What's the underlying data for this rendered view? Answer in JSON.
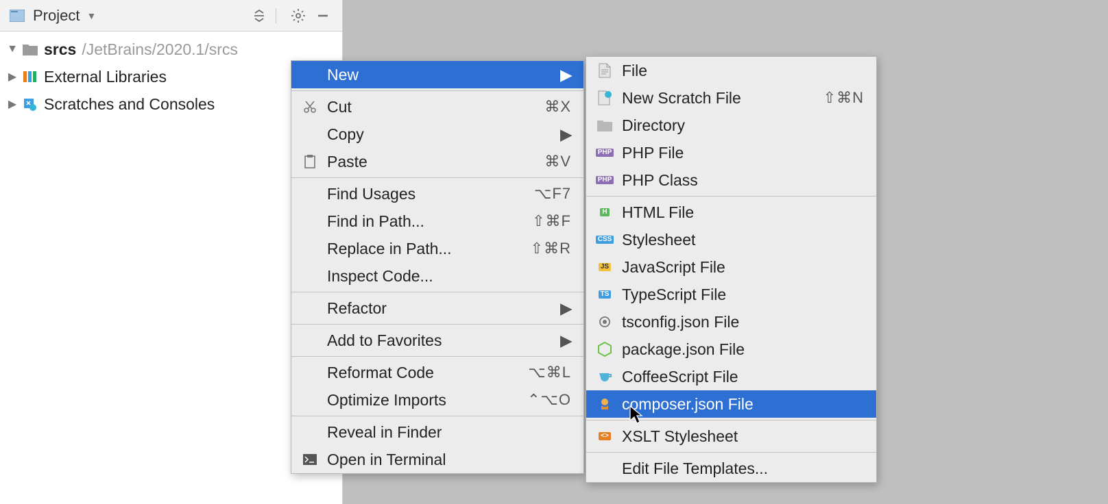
{
  "panel": {
    "title": "Project",
    "path_label": "/JetBrains/2020.1/srcs"
  },
  "tree": {
    "root": "srcs",
    "ext_lib": "External Libraries",
    "scratches": "Scratches and Consoles"
  },
  "context_menu": [
    {
      "label": "New",
      "submenu": true,
      "highlight": true
    },
    {
      "sep": true
    },
    {
      "label": "Cut",
      "shortcut": "⌘X",
      "icon": "cut"
    },
    {
      "label": "Copy",
      "submenu": true
    },
    {
      "label": "Paste",
      "shortcut": "⌘V",
      "icon": "paste"
    },
    {
      "sep": true
    },
    {
      "label": "Find Usages",
      "shortcut": "⌥F7"
    },
    {
      "label": "Find in Path...",
      "shortcut": "⇧⌘F"
    },
    {
      "label": "Replace in Path...",
      "shortcut": "⇧⌘R"
    },
    {
      "label": "Inspect Code..."
    },
    {
      "sep": true
    },
    {
      "label": "Refactor",
      "submenu": true
    },
    {
      "sep": true
    },
    {
      "label": "Add to Favorites",
      "submenu": true
    },
    {
      "sep": true
    },
    {
      "label": "Reformat Code",
      "shortcut": "⌥⌘L"
    },
    {
      "label": "Optimize Imports",
      "shortcut": "⌃⌥O"
    },
    {
      "sep": true
    },
    {
      "label": "Reveal in Finder"
    },
    {
      "label": "Open in Terminal",
      "icon": "terminal"
    }
  ],
  "new_menu": [
    {
      "label": "File",
      "icon": "file"
    },
    {
      "label": "New Scratch File",
      "icon": "scratch",
      "shortcut": "⇧⌘N"
    },
    {
      "label": "Directory",
      "icon": "folder"
    },
    {
      "label": "PHP File",
      "icon": "php"
    },
    {
      "label": "PHP Class",
      "icon": "php"
    },
    {
      "sep": true
    },
    {
      "label": "HTML File",
      "icon": "html"
    },
    {
      "label": "Stylesheet",
      "icon": "css"
    },
    {
      "label": "JavaScript File",
      "icon": "js"
    },
    {
      "label": "TypeScript File",
      "icon": "ts"
    },
    {
      "label": "tsconfig.json File",
      "icon": "tsconfig"
    },
    {
      "label": "package.json File",
      "icon": "node"
    },
    {
      "label": "CoffeeScript File",
      "icon": "coffee"
    },
    {
      "label": "composer.json File",
      "icon": "composer",
      "highlight": true
    },
    {
      "sep": true
    },
    {
      "label": "XSLT Stylesheet",
      "icon": "xslt"
    },
    {
      "sep": true
    },
    {
      "label": "Edit File Templates..."
    }
  ]
}
